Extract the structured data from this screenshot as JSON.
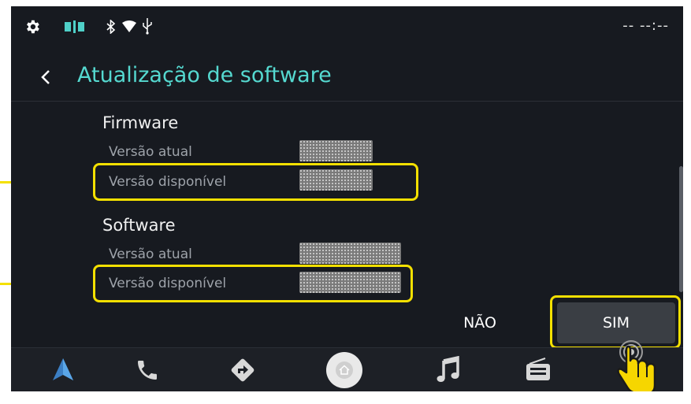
{
  "status_bar": {
    "clock": "-- --:--",
    "icons": [
      "gear-icon",
      "split-screen-icon",
      "bluetooth-icon",
      "wifi-icon",
      "usb-icon"
    ]
  },
  "header": {
    "back_icon": "chevron-left-icon",
    "title": "Atualização de software"
  },
  "sections": [
    {
      "title": "Firmware",
      "rows": [
        {
          "label": "Versão atual"
        },
        {
          "label": "Versão disponível"
        }
      ]
    },
    {
      "title": "Software",
      "rows": [
        {
          "label": "Versão atual"
        },
        {
          "label": "Versão disponível"
        }
      ]
    }
  ],
  "dialog_buttons": {
    "no": "NÃO",
    "yes": "SIM"
  },
  "dock": {
    "items": [
      "navigation-icon",
      "phone-icon",
      "directions-icon",
      "home-icon",
      "music-icon",
      "radio-icon"
    ]
  },
  "colors": {
    "accent": "#55d9d0",
    "highlight": "#f4e000",
    "background": "#171a20"
  }
}
